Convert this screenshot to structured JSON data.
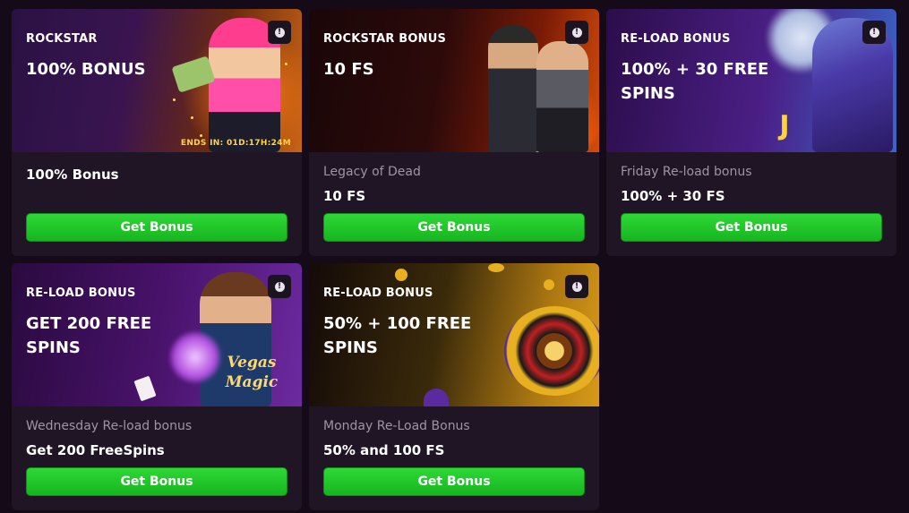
{
  "cards": [
    {
      "banner_subtitle": "ROCKSTAR",
      "banner_headline": "100% BONUS",
      "timer": "ENDS IN: 01D:17H:24M",
      "description": "",
      "title": "100% Bonus",
      "button_label": "Get Bonus"
    },
    {
      "banner_subtitle": "ROCKSTAR BONUS",
      "banner_headline": "10 FS",
      "description": "Legacy of Dead",
      "title": "10 FS",
      "button_label": "Get Bonus"
    },
    {
      "banner_subtitle": "RE-LOAD BONUS",
      "banner_headline": "100% + 30 FREE SPINS",
      "description": "Friday Re-load bonus",
      "title": "100% + 30 FS",
      "button_label": "Get Bonus"
    },
    {
      "banner_subtitle": "RE-LOAD BONUS",
      "banner_headline": "GET 200 FREE SPINS",
      "description": "Wednesday Re-load bonus",
      "title": "Get 200 FreeSpins",
      "button_label": "Get Bonus"
    },
    {
      "banner_subtitle": "RE-LOAD BONUS",
      "banner_headline": "50% + 100 FREE SPINS",
      "description": "Monday Re-Load Bonus",
      "title": "50% and 100 FS",
      "button_label": "Get Bonus"
    }
  ],
  "info_icon_glyph": "!",
  "colors": {
    "background": "#150b18",
    "card": "#1f1524",
    "button": "#22c82b",
    "timer": "#ffd54a"
  }
}
